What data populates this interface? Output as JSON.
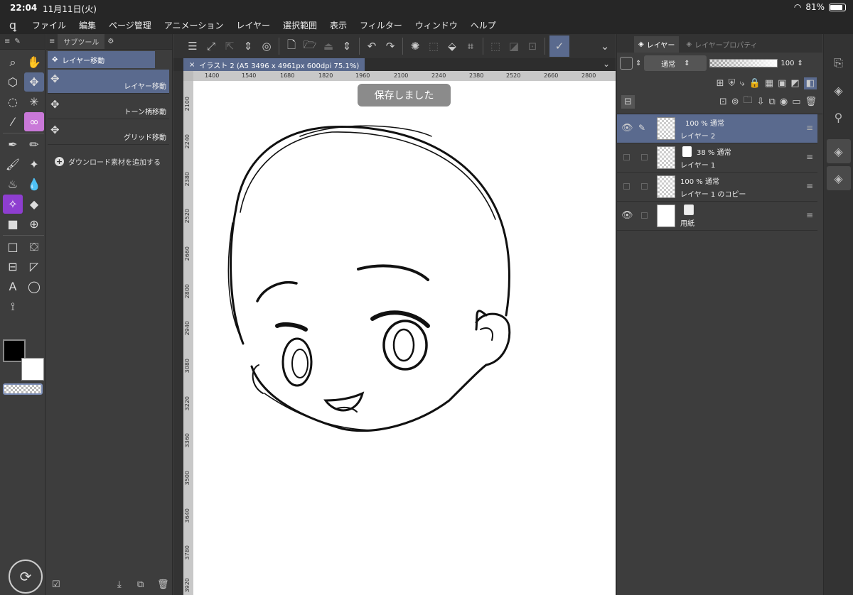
{
  "status": {
    "time": "22:04",
    "date": "11月11日(火)",
    "battery": "81%"
  },
  "menu": [
    "ファイル",
    "編集",
    "ページ管理",
    "アニメーション",
    "レイヤー",
    "選択範囲",
    "表示",
    "フィルター",
    "ウィンドウ",
    "ヘルプ"
  ],
  "subtool": {
    "tab_label": "サブツール",
    "group": "レイヤー移動",
    "items": [
      "レイヤー移動",
      "トーン柄移動",
      "グリッド移動"
    ],
    "add_material": "ダウンロード素材を追加する"
  },
  "canvas": {
    "tab_title": "イラスト 2 (A5 3496 x 4961px 600dpi 75.1%)",
    "toast": "保存しました",
    "hruler": [
      "1400",
      "1540",
      "1680",
      "1820",
      "1960",
      "2100",
      "2240",
      "2380",
      "2520",
      "2660",
      "2800"
    ],
    "vruler": [
      "2100",
      "2240",
      "2380",
      "2520",
      "2660",
      "2800",
      "2940",
      "3080",
      "3220",
      "3360",
      "3500",
      "3640",
      "3780",
      "3920"
    ]
  },
  "layer_panel": {
    "tab_layer": "レイヤー",
    "tab_props": "レイヤープロパティ",
    "blend_mode": "通常",
    "opacity": "100",
    "layers": [
      {
        "sub": "100 % 通常",
        "name": "レイヤー 2"
      },
      {
        "sub": "38 % 通常",
        "name": "レイヤー 1"
      },
      {
        "sub": "100 % 通常",
        "name": "レイヤー 1 のコピー"
      },
      {
        "sub": "",
        "name": "用紙"
      }
    ]
  },
  "colors": {
    "accent": "#5a6a8e",
    "canvas": "#ffffff",
    "panel": "#3d3d3d"
  }
}
